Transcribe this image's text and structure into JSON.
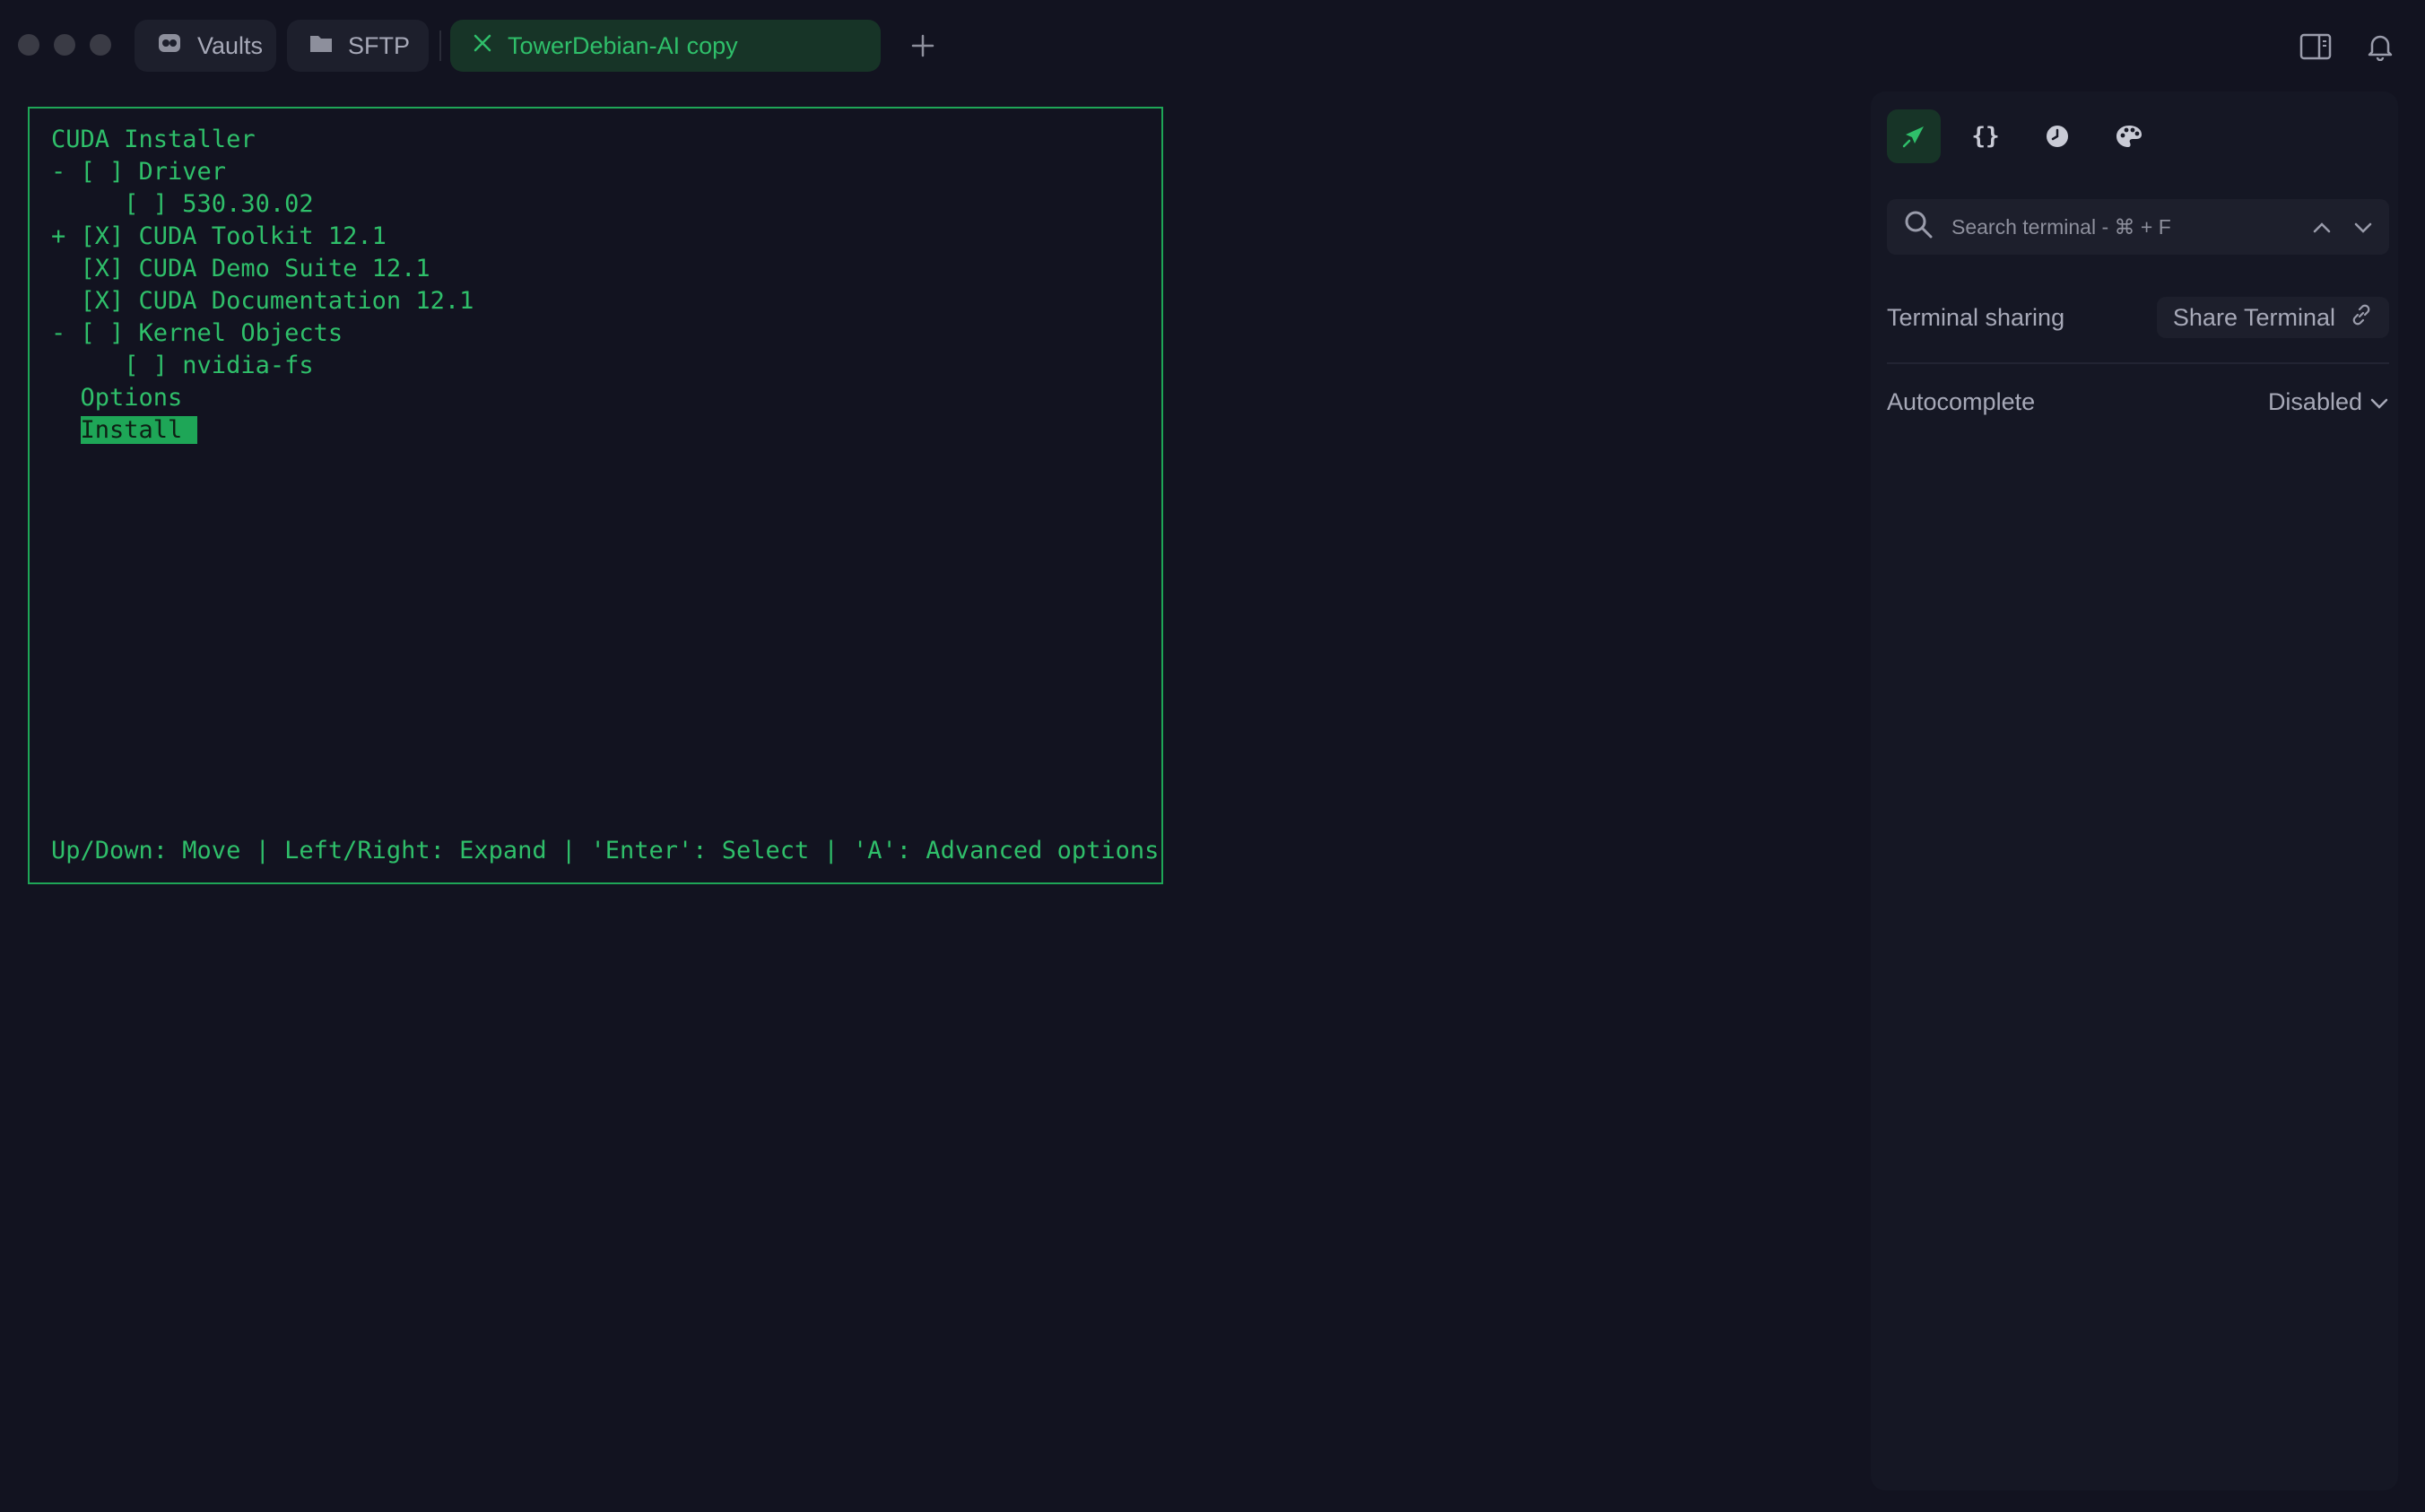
{
  "tabs": {
    "vaults_label": "Vaults",
    "sftp_label": "SFTP",
    "active_label": "TowerDebian-AI copy"
  },
  "terminal": {
    "lines": [
      "CUDA Installer",
      "- [ ] Driver",
      "     [ ] 530.30.02",
      "+ [X] CUDA Toolkit 12.1",
      "  [X] CUDA Demo Suite 12.1",
      "  [X] CUDA Documentation 12.1",
      "- [ ] Kernel Objects",
      "     [ ] nvidia-fs",
      "  Options",
      "  "
    ],
    "install_label": "Install ",
    "help_line": "Up/Down: Move | Left/Right: Expand | 'Enter': Select | 'A': Advanced options"
  },
  "panel": {
    "icons": [
      "rocket-icon",
      "braces-icon",
      "history-icon",
      "palette-icon"
    ],
    "search_placeholder": "Search terminal - ⌘ + F",
    "terminal_sharing_label": "Terminal sharing",
    "share_button_label": "Share Terminal",
    "autocomplete_label": "Autocomplete",
    "autocomplete_value": "Disabled"
  },
  "colors": {
    "background": "#121320",
    "terminal_green": "#2fbf6a",
    "border_green": "#1ea657",
    "panel_bg": "#151724"
  }
}
